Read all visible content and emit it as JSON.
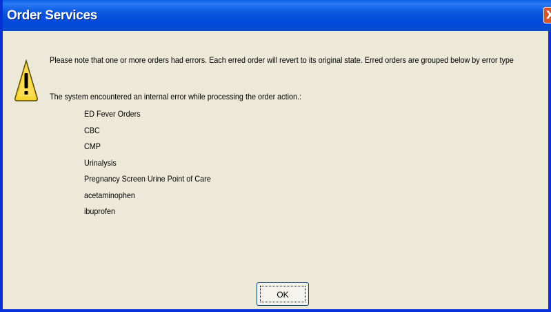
{
  "window": {
    "title": "Order Services",
    "close_glyph": "X"
  },
  "icons": {
    "warning": "warning-icon",
    "close": "close-icon"
  },
  "colors": {
    "titlebar": "#0a4fd0",
    "dialog_bg": "#ece9d8",
    "close_button": "#d8552a",
    "warning_yellow": "#f7d531"
  },
  "message": {
    "notice": "Please note that one or more orders had errors.  Each erred order will revert to its original state.  Erred orders are grouped below by error type",
    "error_heading": "The system encountered an internal error while processing the order action.:",
    "orders": [
      "ED Fever Orders",
      "CBC",
      "CMP",
      "Urinalysis",
      "Pregnancy Screen Urine Point of Care",
      "acetaminophen",
      "ibuprofen"
    ]
  },
  "buttons": {
    "ok_label": "OK"
  }
}
